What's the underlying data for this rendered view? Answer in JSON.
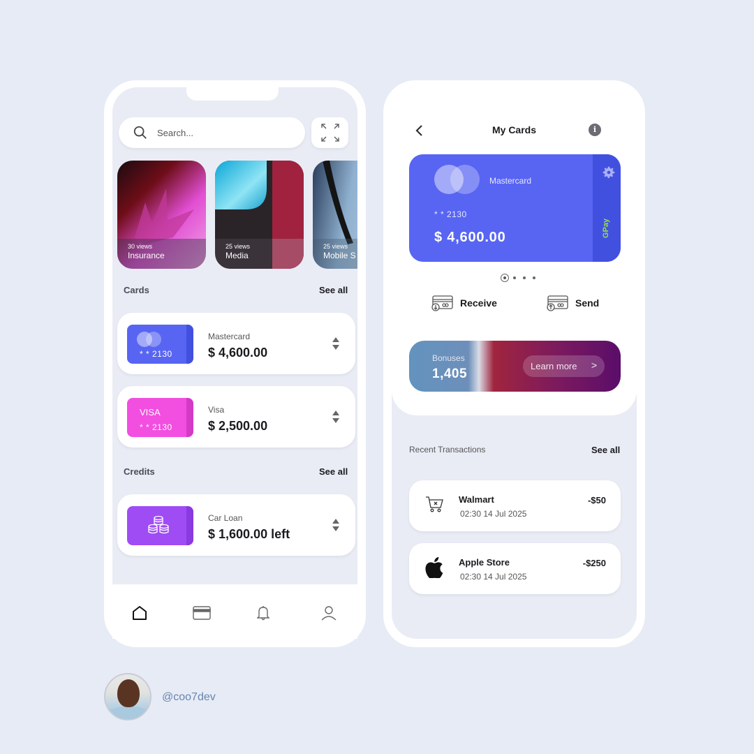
{
  "left_screen": {
    "search": {
      "placeholder": "Search..."
    },
    "stories": [
      {
        "views": "30 views",
        "label": "Insurance"
      },
      {
        "views": "25 views",
        "label": "Media"
      },
      {
        "views": "25 views",
        "label": "Mobile S"
      }
    ],
    "cards_section": {
      "title": "Cards",
      "see_all": "See all"
    },
    "cards": [
      {
        "number": "* *  2130",
        "name": "Mastercard",
        "amount": "$ 4,600.00",
        "color": "#5865f2"
      },
      {
        "brand": "VISA",
        "number": "* *  2130",
        "name": "Visa",
        "amount": "$ 2,500.00",
        "color": "#f24ee0"
      }
    ],
    "credits_section": {
      "title": "Credits",
      "see_all": "See all"
    },
    "credits": [
      {
        "name": "Car Loan",
        "amount": "$ 1,600.00 left",
        "color": "#9f4cf5"
      }
    ],
    "nav": [
      "home-icon",
      "card-icon",
      "bell-icon",
      "user-icon"
    ]
  },
  "right_screen": {
    "title": "My Cards",
    "card": {
      "brand": "Mastercard",
      "number": "* *  2130",
      "amount": "$ 4,600.00",
      "side_label": "GPay",
      "color": "#5865f2"
    },
    "actions": {
      "receive": "Receive",
      "send": "Send"
    },
    "bonus": {
      "label": "Bonuses",
      "value": "1,405",
      "button": "Learn more",
      "chevron": ">"
    },
    "transactions_section": {
      "title": "Recent Transactions",
      "see_all": "See all"
    },
    "transactions": [
      {
        "name": "Walmart",
        "date": "02:30  14 Jul 2025",
        "amount": "-$50",
        "icon": "cart-icon"
      },
      {
        "name": "Apple Store",
        "date": "02:30  14 Jul 2025",
        "amount": "-$250",
        "icon": "apple-icon"
      }
    ]
  },
  "author": {
    "handle": "@coo7dev"
  }
}
